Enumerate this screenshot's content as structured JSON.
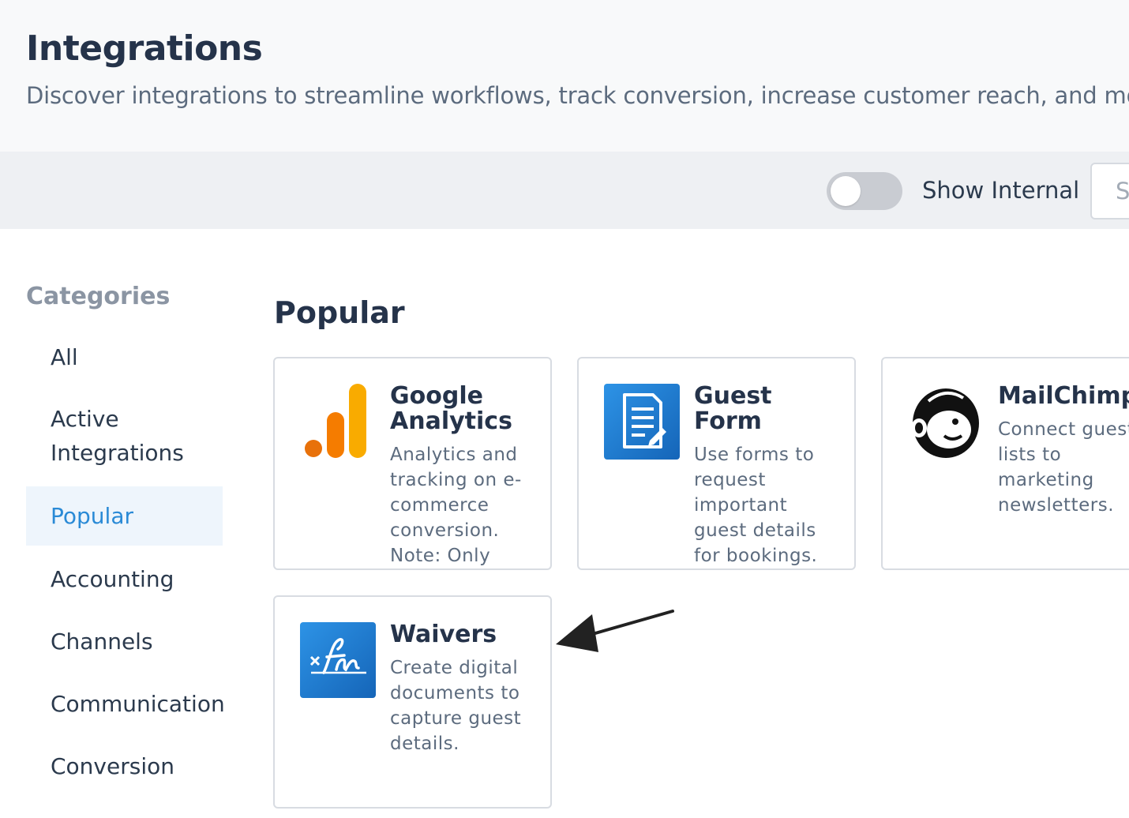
{
  "header": {
    "title": "Integrations",
    "subtitle": "Discover integrations to streamline workflows, track conversion, increase customer reach, and more."
  },
  "toolbar": {
    "toggle_label": "Show Internal",
    "toggle_on": false,
    "search_placeholder": "Search"
  },
  "sidebar": {
    "heading": "Categories",
    "items": [
      {
        "label": "All"
      },
      {
        "label": "Active Integrations"
      },
      {
        "label": "Popular",
        "active": true
      },
      {
        "label": "Accounting"
      },
      {
        "label": "Channels"
      },
      {
        "label": "Communication"
      },
      {
        "label": "Conversion"
      }
    ]
  },
  "main": {
    "section_title": "Popular",
    "cards": [
      {
        "title": "Google Analytics",
        "description": "Analytics and tracking on e-commerce conversion. Note: Only",
        "icon": "google-analytics-logo"
      },
      {
        "title": "Guest Form",
        "description": "Use forms to request important guest details for bookings.",
        "icon": "form-document-icon"
      },
      {
        "title": "MailChimp",
        "description": "Connect guest lists to marketing newsletters.",
        "icon": "mailchimp-logo"
      },
      {
        "title": "Waivers",
        "description": "Create digital documents to capture guest details.",
        "icon": "signature-icon"
      }
    ]
  },
  "colors": {
    "accent": "#2a8ad6",
    "active_bg": "#eef5fc",
    "ga_orange_dark": "#e8710a",
    "ga_orange": "#f57c00",
    "ga_yellow": "#f9ab00",
    "form_blue": "#1f7fd3"
  }
}
